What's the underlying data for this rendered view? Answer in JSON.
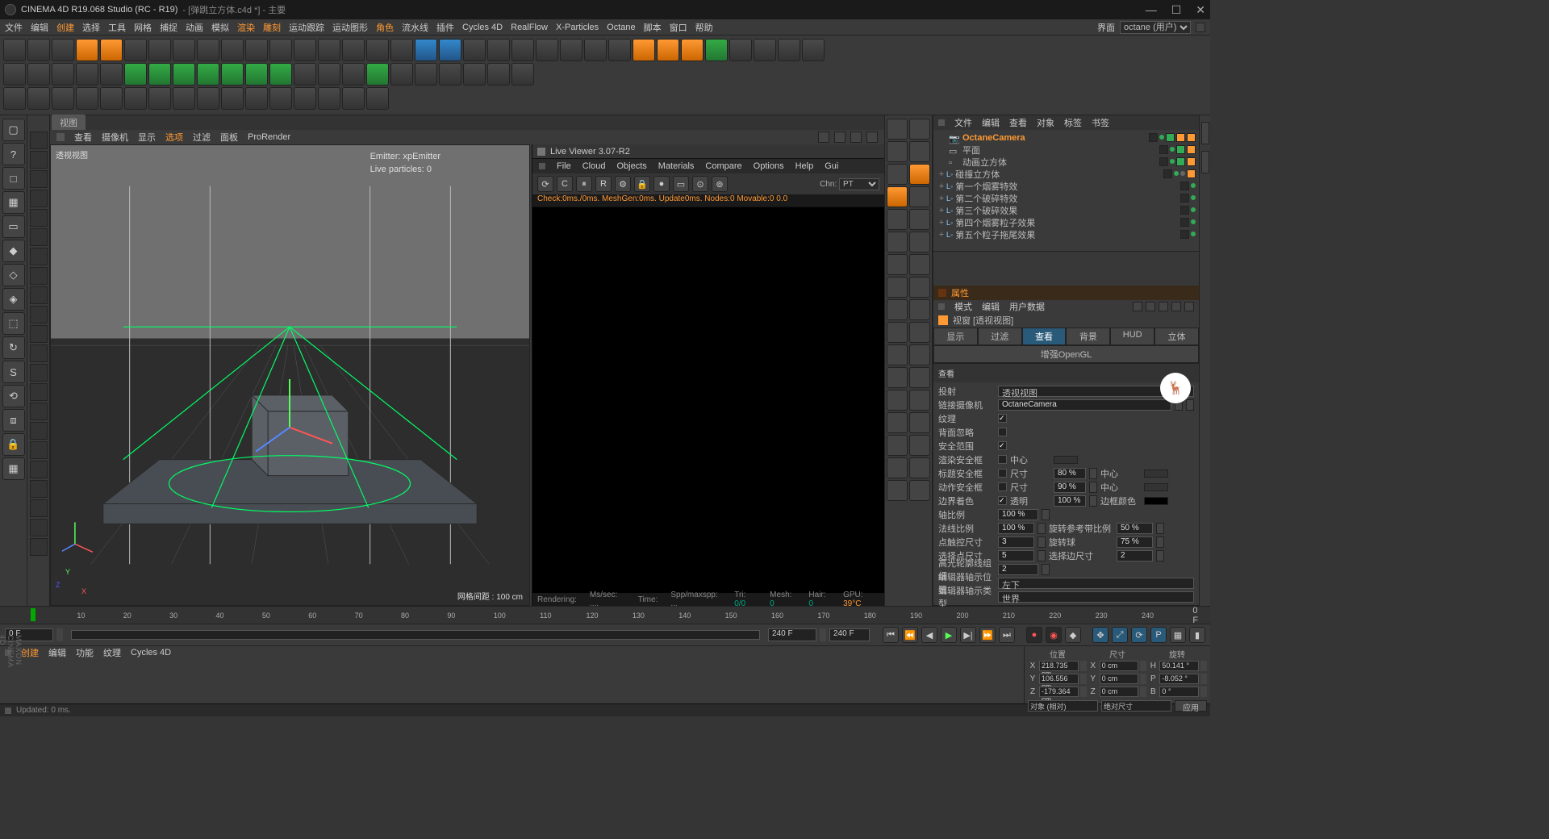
{
  "title": {
    "app": "CINEMA 4D R19.068 Studio (RC - R19)",
    "file": "[弹跳立方体.c4d *]",
    "suffix": "主要"
  },
  "winbtns": {
    "min": "—",
    "max": "☐",
    "close": "✕"
  },
  "menu": [
    "文件",
    "编辑",
    "创建",
    "选择",
    "工具",
    "网格",
    "捕捉",
    "动画",
    "模拟",
    "渲染",
    "雕刻",
    "运动跟踪",
    "运动图形",
    "角色",
    "流水线",
    "插件",
    "Cycles 4D",
    "RealFlow",
    "X-Particles",
    "Octane",
    "脚本",
    "窗口",
    "帮助"
  ],
  "menu_hl": [
    2,
    9,
    10,
    13
  ],
  "layout_label": "界面",
  "layout_val": "octane (用户)",
  "vp_tab": "视图",
  "vp_menu": [
    "查看",
    "摄像机",
    "显示",
    "选项",
    "过滤",
    "面板",
    "ProRender"
  ],
  "vp_menu_hl": [
    3
  ],
  "vp": {
    "label": "透视视图",
    "hud1": "Emitter: xpEmitter",
    "hud2": "Live particles: 0",
    "grid": "网格间距 : 100 cm"
  },
  "lv": {
    "title": "Live Viewer 3.07-R2",
    "menu": [
      "File",
      "Cloud",
      "Objects",
      "Materials",
      "Compare",
      "Options",
      "Help",
      "Gui"
    ],
    "chn_lbl": "Chn:",
    "chn_val": "PT",
    "status": "Check:0ms./0ms.  MeshGen:0ms.  Update0ms.  Nodes:0 Movable:0   0.0",
    "foot": {
      "render": "Rendering:",
      "ms": "Ms/sec: ....",
      "time": "Time:",
      "spp": "Spp/maxspp: ...",
      "tri": "Tri: 0/0",
      "mesh": "Mesh: 0",
      "hair": "Hair: 0",
      "gpu": "GPU:",
      "gput": "39°C"
    }
  },
  "obj_tabs": [
    "文件",
    "编辑",
    "查看",
    "对象",
    "标签",
    "书签"
  ],
  "tree": [
    {
      "name": "OctaneCamera",
      "cls": "oct",
      "exp": "",
      "ind": 0,
      "ico": "📷",
      "tags": [
        "g",
        "o",
        "o"
      ]
    },
    {
      "name": "平面",
      "exp": "",
      "ind": 0,
      "ico": "▭",
      "tags": [
        "g",
        "o"
      ]
    },
    {
      "name": "动画立方体",
      "exp": "",
      "ind": 0,
      "ico": "▫",
      "tags": [
        "g",
        "o"
      ]
    },
    {
      "name": "碰撞立方体",
      "exp": "+",
      "ind": 0,
      "lo": true,
      "tags": [
        "cg",
        "o"
      ]
    },
    {
      "name": "第一个烟雾特效",
      "exp": "+",
      "ind": 0,
      "lo": true,
      "tags": []
    },
    {
      "name": "第二个破碎特效",
      "exp": "+",
      "ind": 0,
      "lo": true,
      "tags": []
    },
    {
      "name": "第三个破碎效果",
      "exp": "+",
      "ind": 0,
      "lo": true,
      "tags": []
    },
    {
      "name": "第四个烟雾粒子效果",
      "exp": "+",
      "ind": 0,
      "lo": true,
      "tags": []
    },
    {
      "name": "第五个粒子拖尾效果",
      "exp": "+",
      "ind": 0,
      "lo": true,
      "tags": []
    }
  ],
  "attr": {
    "head": "属性",
    "menu": [
      "模式",
      "编辑",
      "用户数据"
    ],
    "title": "视窗 [透视视图]",
    "tabs": [
      "显示",
      "过滤",
      "查看",
      "背景",
      "HUD",
      "立体",
      "增强OpenGL"
    ],
    "tabs_sel": 2,
    "section": "查看",
    "rows": [
      {
        "t": "dd",
        "lbl": "投射",
        "val": "透视视图"
      },
      {
        "t": "fld2",
        "lbl": "链接摄像机",
        "val": "OctaneCamera"
      },
      {
        "t": "chk",
        "lbl": "纹理",
        "on": true
      },
      {
        "t": "chk",
        "lbl": "背面忽略",
        "on": false
      },
      {
        "t": "chk",
        "lbl": "安全范围",
        "on": true
      },
      {
        "t": "chk2",
        "lbl": "渲染安全框",
        "on": false,
        "lbl2": "中心",
        "dots": true
      },
      {
        "t": "chk2",
        "lbl": "标题安全框",
        "on": false,
        "lbl2": "尺寸",
        "val2": "80 %",
        "lbl3": "中心",
        "dots": true
      },
      {
        "t": "chk2",
        "lbl": "动作安全框",
        "on": false,
        "lbl2": "尺寸",
        "val2": "90 %",
        "lbl3": "中心",
        "dots": true
      },
      {
        "t": "mix",
        "lbl": "边界着色",
        "on": true,
        "lbl2": "透明",
        "val2": "100 %",
        "lbl3": "边框颜色",
        "color": "#000"
      },
      {
        "t": "pct",
        "lbl": "轴比例",
        "val": "100 %"
      },
      {
        "t": "pct2",
        "lbl": "法线比例",
        "val": "100 %",
        "lbl2": "旋转参考带比例",
        "val2": "50 %"
      },
      {
        "t": "pct2",
        "lbl": "点触控尺寸",
        "val": "3",
        "lbl2": "旋转球",
        "val2": "75 %"
      },
      {
        "t": "pct2",
        "lbl": "选择点尺寸",
        "val": "5",
        "lbl2": "选择边尺寸",
        "val2": "2"
      },
      {
        "t": "pct",
        "lbl": "高光轮廓线组细",
        "val": "2"
      },
      {
        "t": "dd",
        "lbl": "编辑器轴示位置",
        "val": "左下"
      },
      {
        "t": "dd",
        "lbl": "编辑器轴示类型",
        "val": "世界"
      }
    ]
  },
  "timeline": {
    "ticks": [
      "0",
      "10",
      "20",
      "30",
      "40",
      "50",
      "60",
      "70",
      "80",
      "90",
      "100",
      "110",
      "120",
      "130",
      "140",
      "150",
      "160",
      "170",
      "180",
      "190",
      "200",
      "210",
      "220",
      "230",
      "240"
    ],
    "end": "0 F",
    "cur": "0 F",
    "max": "240 F",
    "max2": "240 F"
  },
  "mat_tabs": [
    "创建",
    "编辑",
    "功能",
    "纹理",
    "Cycles 4D"
  ],
  "coord": {
    "heads": [
      "位置",
      "尺寸",
      "旋转"
    ],
    "rows": [
      {
        "a": "X",
        "p": "218.735 cm",
        "s": "0 cm",
        "r": "50.141 °"
      },
      {
        "a": "Y",
        "p": "106.556 cm",
        "s": "0 cm",
        "r": "-8.052 °"
      },
      {
        "a": "Z",
        "p": "-179.364 cm",
        "s": "0 cm",
        "r": "0 °"
      }
    ],
    "dd1": "对象 (相对)",
    "dd2": "绝对尺寸",
    "btn": "应用"
  },
  "status": "Updated: 0 ms.",
  "maxon": "MAXON CINEMA 4D"
}
